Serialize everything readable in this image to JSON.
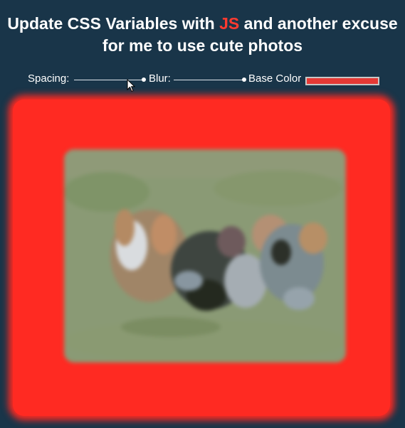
{
  "header": {
    "title_before": "Update CSS Variables with",
    "title_highlight": "JS",
    "title_after": "and another excuse for me to use cute photos"
  },
  "controls": {
    "spacing": {
      "label": "Spacing:",
      "value_fraction": 0.98
    },
    "blur": {
      "label": "Blur:",
      "value_fraction": 1.0
    },
    "base_color": {
      "label": "Base Color",
      "value": "#e53935"
    }
  },
  "icons": {
    "cursor": "arrow-cursor-icon"
  },
  "colors": {
    "background": "#193549",
    "accent": "#ff3b30",
    "frame": "#ff2a22"
  }
}
